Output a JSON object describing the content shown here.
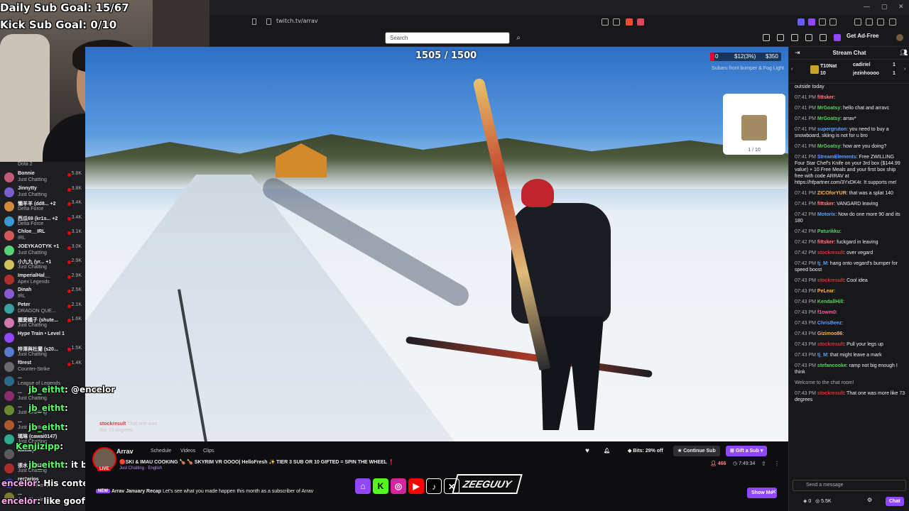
{
  "browser": {
    "url": "twitch.tv/arrav"
  },
  "webcam": {
    "daily_sub_goal": "Daily Sub Goal: 15/67",
    "kick_sub_goal": "Kick Sub Goal: 0/10"
  },
  "header": {
    "search_placeholder": "Search",
    "get_ad_free": "Get Ad-Free"
  },
  "sidebar": {
    "top_category": "Dota 2",
    "items": [
      {
        "name": "Bonnie",
        "category": "Just Chatting",
        "viewers": "5.8K",
        "avatar": "#c45a7a"
      },
      {
        "name": "Jinnytty",
        "category": "Just Chatting",
        "viewers": "3.8K",
        "avatar": "#7b5ed0"
      },
      {
        "name": "懶羊羊 (dd8...  +2",
        "category": "Delta Force",
        "viewers": "3.4K",
        "avatar": "#d08a3a"
      },
      {
        "name": "西瓜69 (kr1s...  +2",
        "category": "Delta Force",
        "viewers": "3.4K",
        "avatar": "#3a9ad0"
      },
      {
        "name": "Chloe__IRL",
        "category": "IRL",
        "viewers": "3.1K",
        "avatar": "#d05a5a"
      },
      {
        "name": "JOEYKAOTYK  +1",
        "category": "Just Chatting",
        "viewers": "3.0K",
        "avatar": "#5ad07a"
      },
      {
        "name": "小九九 (yr...  +1",
        "category": "Just Chatting",
        "viewers": "2.9K",
        "avatar": "#d0c25a"
      },
      {
        "name": "ImperialHal__",
        "category": "Apex Legends",
        "viewers": "2.9K",
        "avatar": "#b03030"
      },
      {
        "name": "Dinah",
        "category": "IRL",
        "viewers": "2.5K",
        "avatar": "#8a5ad0"
      },
      {
        "name": "Peter",
        "category": "DRAGON QUE...",
        "viewers": "2.1K",
        "avatar": "#3aa0a0"
      },
      {
        "name": "麗愛橘子 (shute...",
        "category": "Just Chatting",
        "viewers": "1.6K",
        "avatar": "#d07ab0"
      },
      {
        "name": "Hype Train • Level 1",
        "category": "",
        "viewers": "",
        "avatar": "#9147ff"
      },
      {
        "name": "梓澤與杜蘭 (s20...",
        "category": "Just Chatting",
        "viewers": "1.5K",
        "avatar": "#5a7ad0"
      },
      {
        "name": "f0rest",
        "category": "Counter-Strike",
        "viewers": "1.4K",
        "avatar": "#6a6a6a"
      },
      {
        "name": "...",
        "category": "League of Legends",
        "viewers": "",
        "avatar": "#2d6a8a"
      },
      {
        "name": "...",
        "category": "Just Chatting",
        "viewers": "",
        "avatar": "#8a2d6a"
      },
      {
        "name": "...",
        "category": "Just Chatting",
        "viewers": "",
        "avatar": "#6a8a2d"
      },
      {
        "name": "...",
        "category": "Just Chatting",
        "viewers": "",
        "avatar": "#aa5a2d"
      },
      {
        "name": "瑪琳 (cawai0147)",
        "category": "Just Chatting",
        "viewers": "",
        "avatar": "#2daa8a"
      },
      {
        "name": "kilittwy",
        "category": "",
        "viewers": "",
        "avatar": "#5a5a5a"
      },
      {
        "name": "張水 (jt_123)",
        "category": "Just Chatting",
        "viewers": "",
        "avatar": "#aa2d2d"
      },
      {
        "name": "restarips",
        "category": "Etheria: Restart",
        "viewers": "",
        "avatar": "#2d2daa"
      },
      {
        "name": "...",
        "category": "Just Chatting",
        "viewers": "",
        "avatar": "#7a7a2d"
      }
    ]
  },
  "video": {
    "sub_counter": "1505 / 1500",
    "goal_amount": "$12(3%)",
    "goal_target": "$350",
    "goal_left": "0",
    "goal_fraction": 0.03,
    "goal_title": "Subaru front bumper & Fog Light",
    "card_count": "1 / 10",
    "overlay_donation_name": "stockresult",
    "overlay_donation_text": "That one was",
    "overlay_donation_text2": "like 73 degrees"
  },
  "overlay_chat": [
    {
      "user": "jb_eitht",
      "text": ": @encelor"
    },
    {
      "user": "jb_eitht",
      "text": ":"
    },
    {
      "user": "jb_eitht",
      "text": ":"
    },
    {
      "user": "Kenjizipp",
      "text": ":"
    },
    {
      "user": "jb_eitht",
      "text": ": it be fun if he had a head cam"
    },
    {
      "user": "encelor",
      "text": ": His content might grow on Kick maybe"
    },
    {
      "user": "encelor",
      "text": ": like goofy stuff"
    }
  ],
  "channel": {
    "name": "Arrav",
    "live": "LIVE",
    "tabs": [
      "Schedule",
      "Videos",
      "Clips"
    ],
    "title": "🔴SKI & IMAU COOKING 🍗 🍗 SKYRIM VR OOOO| HelloFresh ✨ TIER 3 SUB OR 10 GIFTED = SPIN THE WHEEL ❗",
    "category": "Just Chatting",
    "language": "English",
    "bits_label": "Bits: 29% off",
    "continue_sub": "Continue Sub",
    "gift_sub": "Gift a Sub",
    "viewers": "466",
    "uptime": "7:49:34",
    "promo_badge": "NEW",
    "promo_title": "Arrav January Recap",
    "promo_text": "Let's see what you made happen this month as a subscriber of Arrav",
    "show_me": "Show Me",
    "zee_logo": "ZEEGUUY"
  },
  "chat": {
    "title": "Stream Chat",
    "gifter1_name": "T10Nat",
    "gifter1_count": "10",
    "gifter2_name": "cadiriel",
    "gifter2_count": "1",
    "gifter3_name": "jezinhoooo",
    "gifter3_count": "1",
    "messages": [
      {
        "time": "",
        "user": "",
        "color": "#efeff1",
        "text": "outside today"
      },
      {
        "time": "07:41 PM",
        "user": "fittsker",
        "color": "#ff7f7f",
        "text": ":"
      },
      {
        "time": "07:41 PM",
        "user": "MrGoatsy",
        "color": "#5ad05a",
        "text": ": hello chat and arravc"
      },
      {
        "time": "07:41 PM",
        "user": "MrGoatsy",
        "color": "#5ad05a",
        "text": ": arrav*"
      },
      {
        "time": "07:41 PM",
        "user": "supergruton",
        "color": "#5aa0ff",
        "text": ": you need to buy a snowboard, skiing is not for u bro"
      },
      {
        "time": "07:41 PM",
        "user": "MrGoatsy",
        "color": "#5ad05a",
        "text": ": how are you doing?"
      },
      {
        "time": "07:41 PM",
        "user": "StreamElements",
        "color": "#5aa0ff",
        "text": ": Free ZWILLING Four Star Chef's Knife on your 3rd box ($144.99 value) + 10 Free Meals and your first box ship free with code ARRAV at https://hfpartner.com/3YxDK4r. It supports me!"
      },
      {
        "time": "07:41 PM",
        "user": "ZICOforYUR",
        "color": "#ffb34d",
        "text": ": that was a splat 140"
      },
      {
        "time": "07:41 PM",
        "user": "fittsker",
        "color": "#ff7f7f",
        "text": ": VANGARD leaving"
      },
      {
        "time": "07:42 PM",
        "user": "Motorix",
        "color": "#5aa0ff",
        "text": ": Now do one more 90 and its 180"
      },
      {
        "time": "07:42 PM",
        "user": "Paturikku",
        "color": "#5ad05a",
        "text": ":"
      },
      {
        "time": "07:42 PM",
        "user": "fittsker",
        "color": "#ff7f7f",
        "text": ": fuckgard in leaving"
      },
      {
        "time": "07:42 PM",
        "user": "stockresult",
        "color": "#d03a3a",
        "text": ": over vegard"
      },
      {
        "time": "07:42 PM",
        "user": "tj_M",
        "color": "#5aa0ff",
        "text": ": hang onto vegard's bumper for speed boost"
      },
      {
        "time": "07:43 PM",
        "user": "stockresult",
        "color": "#d03a3a",
        "text": ": Cool idea"
      },
      {
        "time": "07:43 PM",
        "user": "PeLear",
        "color": "#ffb34d",
        "text": ":"
      },
      {
        "time": "07:43 PM",
        "user": "KendallHill",
        "color": "#5ad05a",
        "text": ":"
      },
      {
        "time": "07:43 PM",
        "user": "f1owm0",
        "color": "#ff5aa0",
        "text": ":"
      },
      {
        "time": "07:43 PM",
        "user": "ChrisBeez",
        "color": "#5aa0ff",
        "text": ":"
      },
      {
        "time": "07:43 PM",
        "user": "Gizimoo86",
        "color": "#ffb34d",
        "text": ":"
      },
      {
        "time": "07:43 PM",
        "user": "stockresult",
        "color": "#d03a3a",
        "text": ": Pull your legs up"
      },
      {
        "time": "07:43 PM",
        "user": "tj_M",
        "color": "#5aa0ff",
        "text": ": that might leave a mark"
      },
      {
        "time": "07:43 PM",
        "user": "stefancooke",
        "color": "#5ad05a",
        "text": ": ramp not big enough I think"
      },
      {
        "time": "",
        "user": "",
        "color": "#adadb8",
        "text": "Welcome to the chat room!"
      },
      {
        "time": "07:43 PM",
        "user": "stockresult",
        "color": "#d03a3a",
        "text": ": That one was more like 73 degrees"
      }
    ],
    "input_placeholder": "Send a message",
    "points": "0",
    "points2": "5.5K",
    "chat_button": "Chat"
  }
}
